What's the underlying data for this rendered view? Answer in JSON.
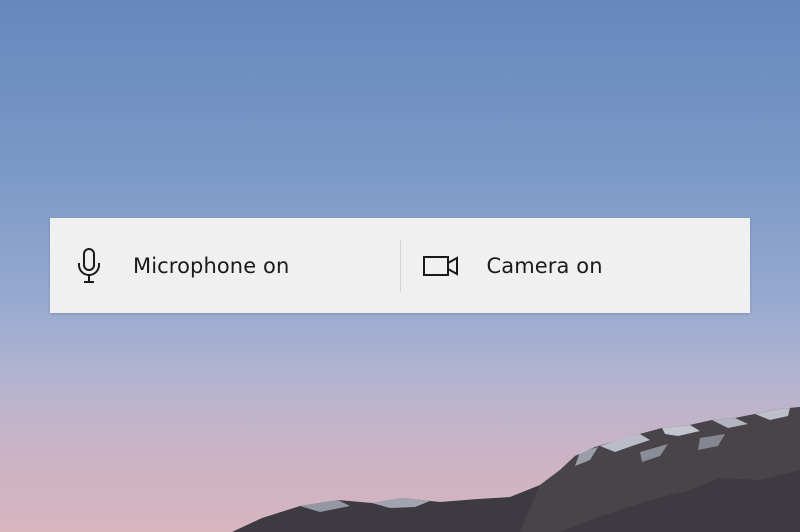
{
  "background": {
    "sky_top_color": "#6688bd",
    "sky_bottom_color": "#d7b5bf",
    "mountain_color": "#3b3a3f",
    "snow_color": "#c9cdd8"
  },
  "toast": {
    "background_color": "#f0f0f0",
    "items": [
      {
        "icon": "microphone-icon",
        "label": "Microphone on"
      },
      {
        "icon": "camera-icon",
        "label": "Camera on"
      }
    ]
  }
}
